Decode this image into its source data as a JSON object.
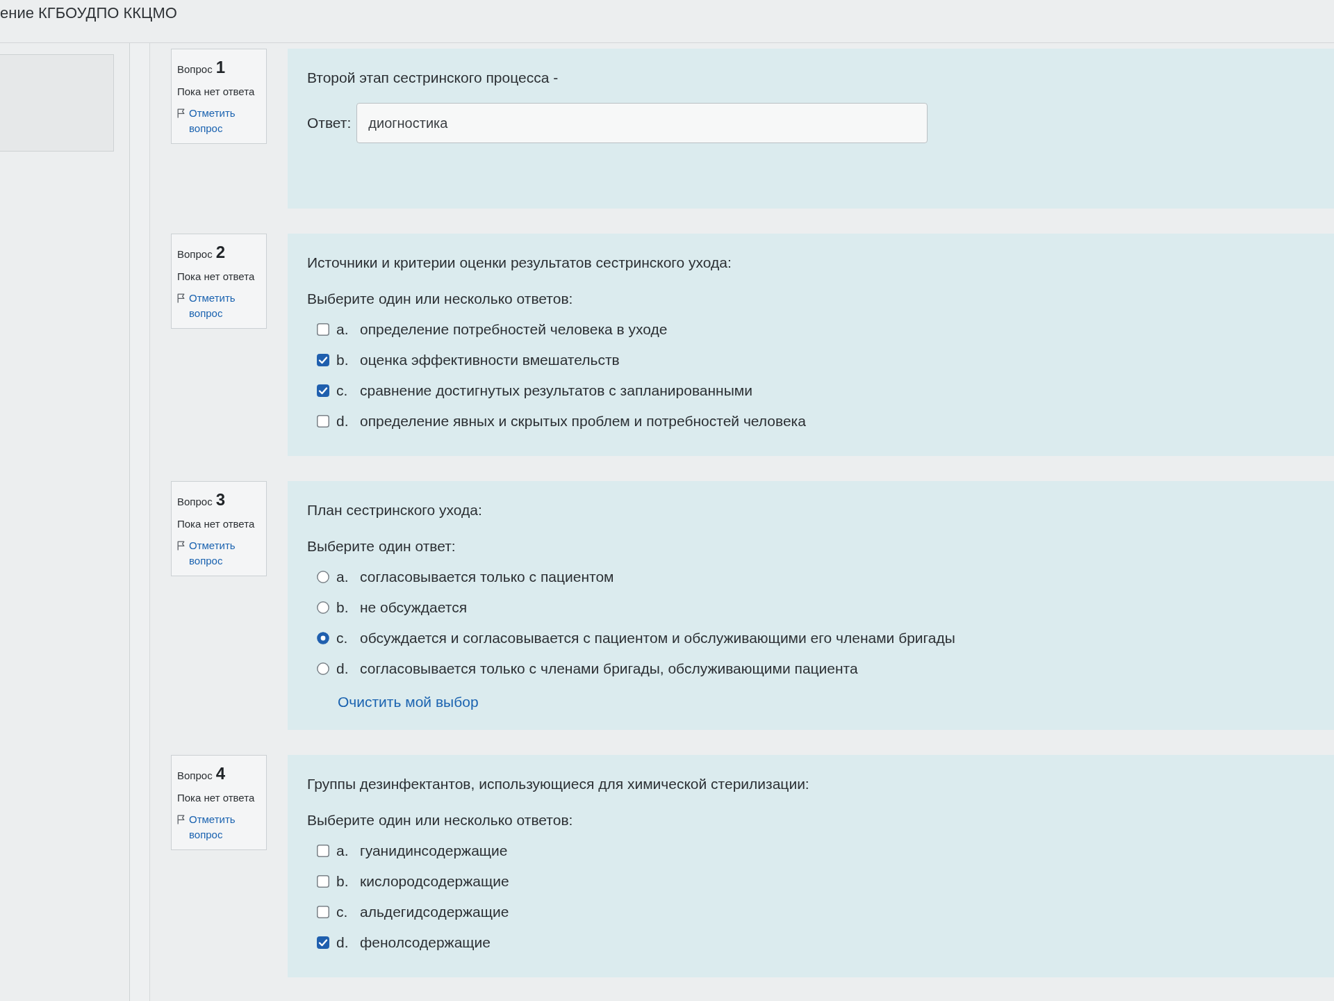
{
  "header": {
    "title": "ение КГБОУДПО ККЦМО"
  },
  "questions": [
    {
      "label": "Вопрос",
      "number": "1",
      "status": "Пока нет ответа",
      "flag_link": "Отметить вопрос",
      "kind": "text",
      "text": "Второй этап сестринского процесса -",
      "answer_label": "Ответ:",
      "answer_value": "диогностика"
    },
    {
      "label": "Вопрос",
      "number": "2",
      "status": "Пока нет ответа",
      "flag_link": "Отметить вопрос",
      "kind": "multi",
      "text": "Источники и критерии оценки результатов сестринского ухода:",
      "prompt": "Выберите один или несколько ответов:",
      "options": [
        {
          "letter": "a.",
          "text": "определение потребностей человека в уходе",
          "checked": false
        },
        {
          "letter": "b.",
          "text": "оценка эффективности вмешательств",
          "checked": true
        },
        {
          "letter": "c.",
          "text": "сравнение достигнутых результатов с запланированными",
          "checked": true
        },
        {
          "letter": "d.",
          "text": "определение явных и скрытых проблем и потребностей человека",
          "checked": false
        }
      ]
    },
    {
      "label": "Вопрос",
      "number": "3",
      "status": "Пока нет ответа",
      "flag_link": "Отметить вопрос",
      "kind": "single",
      "text": "План сестринского ухода:",
      "prompt": "Выберите один ответ:",
      "options": [
        {
          "letter": "a.",
          "text": "согласовывается только с пациентом",
          "selected": false
        },
        {
          "letter": "b.",
          "text": "не обсуждается",
          "selected": false
        },
        {
          "letter": "c.",
          "text": "обсуждается и согласовывается с пациентом и обслуживающими его членами бригады",
          "selected": true
        },
        {
          "letter": "d.",
          "text": "согласовывается только с членами бригады, обслуживающими пациента",
          "selected": false
        }
      ],
      "clear_link": "Очистить мой выбор"
    },
    {
      "label": "Вопрос",
      "number": "4",
      "status": "Пока нет ответа",
      "flag_link": "Отметить вопрос",
      "kind": "multi",
      "text": "Группы дезинфектантов, использующиеся для химической стерилизации:",
      "prompt": "Выберите один или несколько ответов:",
      "options": [
        {
          "letter": "a.",
          "text": "гуанидинсодержащие",
          "checked": false
        },
        {
          "letter": "b.",
          "text": "кислородсодержащие",
          "checked": false
        },
        {
          "letter": "c.",
          "text": "альдегидсодержащие",
          "checked": false
        },
        {
          "letter": "d.",
          "text": "фенолсодержащие",
          "checked": true
        }
      ]
    }
  ]
}
